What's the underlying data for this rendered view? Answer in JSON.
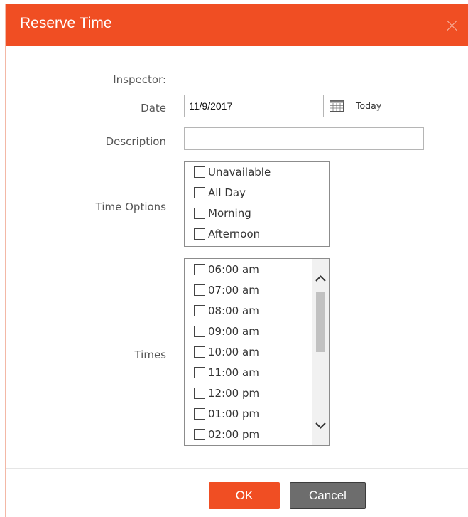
{
  "dialog": {
    "title": "Reserve Time",
    "close_icon": "close-icon"
  },
  "form": {
    "inspector_label": "Inspector:",
    "date_label": "Date",
    "date_value": "11/9/2017",
    "calendar_icon": "calendar-icon",
    "today_label": "Today",
    "description_label": "Description",
    "description_value": "",
    "time_options_label": "Time Options",
    "time_options": [
      {
        "label": "Unavailable",
        "checked": false
      },
      {
        "label": "All Day",
        "checked": false
      },
      {
        "label": "Morning",
        "checked": false
      },
      {
        "label": "Afternoon",
        "checked": false
      }
    ],
    "times_label": "Times",
    "times": [
      {
        "label": "06:00 am",
        "checked": false
      },
      {
        "label": "07:00 am",
        "checked": false
      },
      {
        "label": "08:00 am",
        "checked": false
      },
      {
        "label": "09:00 am",
        "checked": false
      },
      {
        "label": "10:00 am",
        "checked": false
      },
      {
        "label": "11:00 am",
        "checked": false
      },
      {
        "label": "12:00 pm",
        "checked": false
      },
      {
        "label": "01:00 pm",
        "checked": false
      },
      {
        "label": "02:00 pm",
        "checked": false
      }
    ]
  },
  "footer": {
    "ok_label": "OK",
    "cancel_label": "Cancel"
  },
  "colors": {
    "accent": "#f04e23",
    "cancel": "#6d6d6d"
  }
}
